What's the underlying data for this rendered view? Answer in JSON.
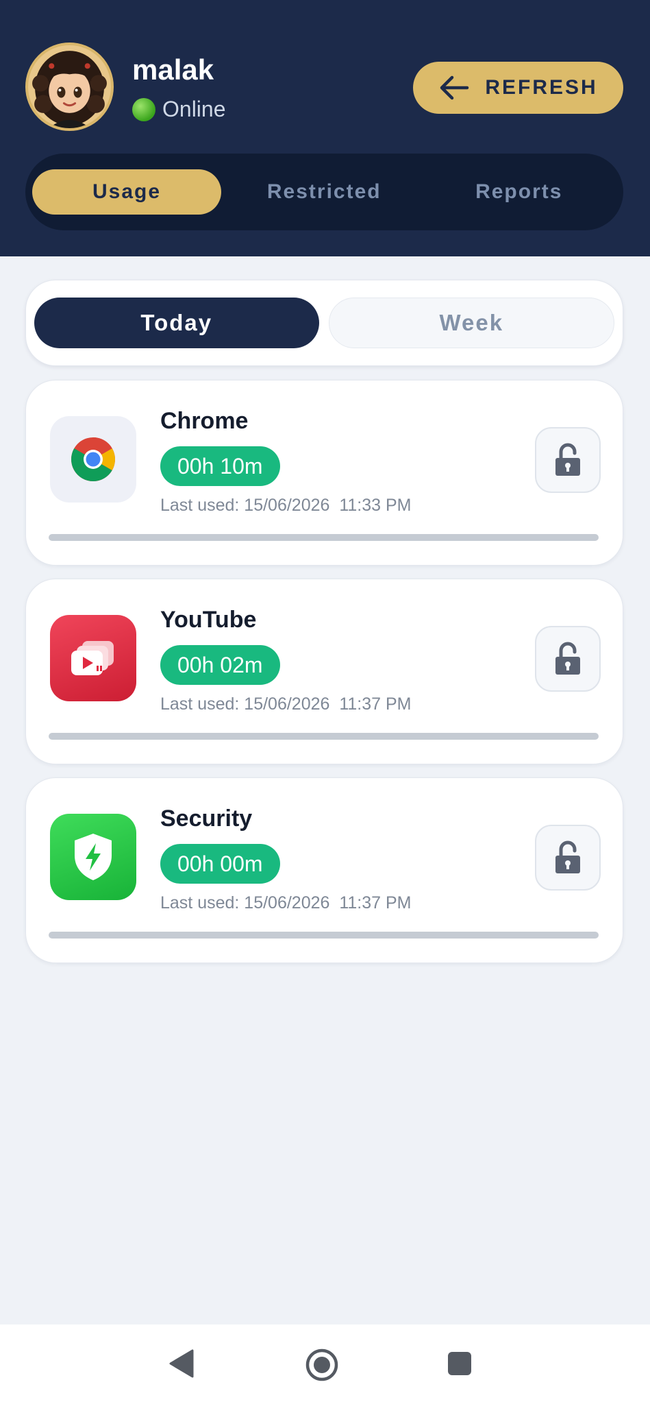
{
  "user": {
    "name": "malak",
    "status": "Online",
    "avatar_icon": "girl-avatar-icon"
  },
  "header": {
    "refresh_label": "REFRESH",
    "refresh_icon": "arrow-left-icon"
  },
  "main_tabs": [
    {
      "label": "Usage",
      "active": true
    },
    {
      "label": "Restricted",
      "active": false
    },
    {
      "label": "Reports",
      "active": false
    }
  ],
  "period_tabs": [
    {
      "label": "Today",
      "active": true
    },
    {
      "label": "Week",
      "active": false
    }
  ],
  "apps": [
    {
      "name": "Chrome",
      "usage": "00h 10m",
      "last_used": "Last used: 15/06/2026  11:33 PM",
      "icon": "chrome-icon",
      "locked": false,
      "progress": 0
    },
    {
      "name": "YouTube",
      "usage": "00h 02m",
      "last_used": "Last used: 15/06/2026  11:37 PM",
      "icon": "youtube-icon",
      "locked": false,
      "progress": 0
    },
    {
      "name": "Security",
      "usage": "00h 00m",
      "last_used": "Last used: 15/06/2026  11:37 PM",
      "icon": "security-shield-icon",
      "locked": false,
      "progress": 0
    }
  ],
  "navbar": {
    "back_icon": "back-triangle-icon",
    "home_icon": "home-circle-icon",
    "recents_icon": "recents-square-icon"
  },
  "colors": {
    "header_bg": "#1c2a4a",
    "accent_gold": "#dcbb6a",
    "usage_green": "#19b97f",
    "page_bg": "#eff2f7"
  }
}
